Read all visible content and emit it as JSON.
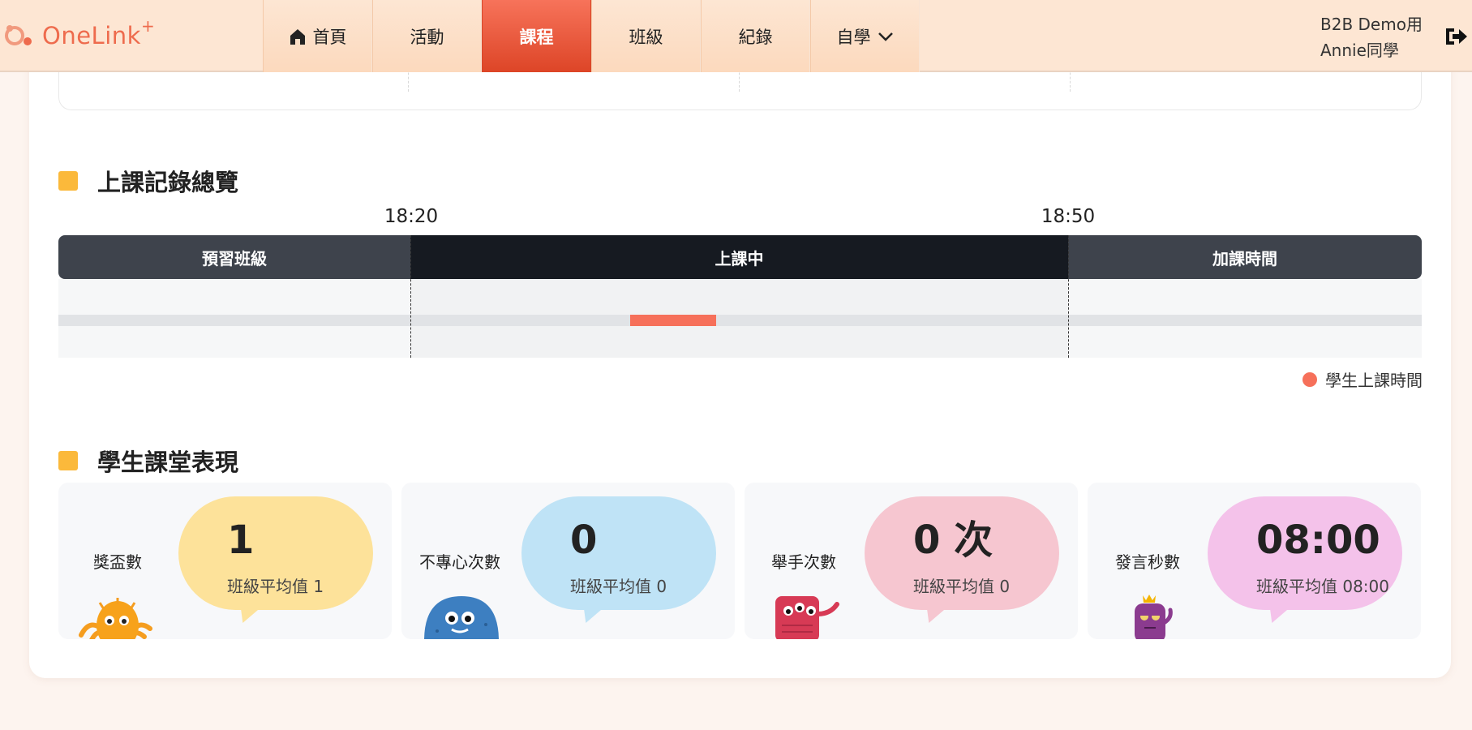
{
  "header": {
    "logo_text": "OneLink",
    "logo_plus": "+",
    "nav": [
      {
        "label": "首頁",
        "icon": "home-icon"
      },
      {
        "label": "活動"
      },
      {
        "label": "課程",
        "active": true
      },
      {
        "label": "班級"
      },
      {
        "label": "紀錄"
      },
      {
        "label": "自學",
        "icon": "chevron-down-icon"
      }
    ],
    "user_line1": "B2B Demo用",
    "user_line2": "Annie同學",
    "logout_icon": "logout-icon"
  },
  "timeline_section": {
    "title": "上課記錄總覽",
    "start_time": "18:20",
    "end_time": "18:50",
    "segments": [
      "預習班級",
      "上課中",
      "加課時間"
    ],
    "legend": "學生上課時間",
    "student_color": "#f6705a"
  },
  "performance_section": {
    "title": "學生課堂表現",
    "cards": [
      {
        "label": "獎盃數",
        "value": "1",
        "avg": "班級平均值 1",
        "color": "#fde29a",
        "mascot": "orange-octopus-mascot"
      },
      {
        "label": "不專心次數",
        "value": "0",
        "avg": "班級平均值 0",
        "color": "#bfe3f6",
        "mascot": "blue-monster-mascot"
      },
      {
        "label": "舉手次數",
        "value": "0 次",
        "avg": "班級平均值 0",
        "color": "#f6c6d0",
        "mascot": "red-monster-mascot"
      },
      {
        "label": "發言秒數",
        "value": "08:00",
        "avg": "班級平均值 08:00",
        "color": "#f4c2ea",
        "mascot": "purple-monster-mascot"
      }
    ]
  },
  "colors": {
    "accent": "#ee6b4d",
    "section_marker": "#fbb93b",
    "header_bg": "#fde6d3"
  }
}
